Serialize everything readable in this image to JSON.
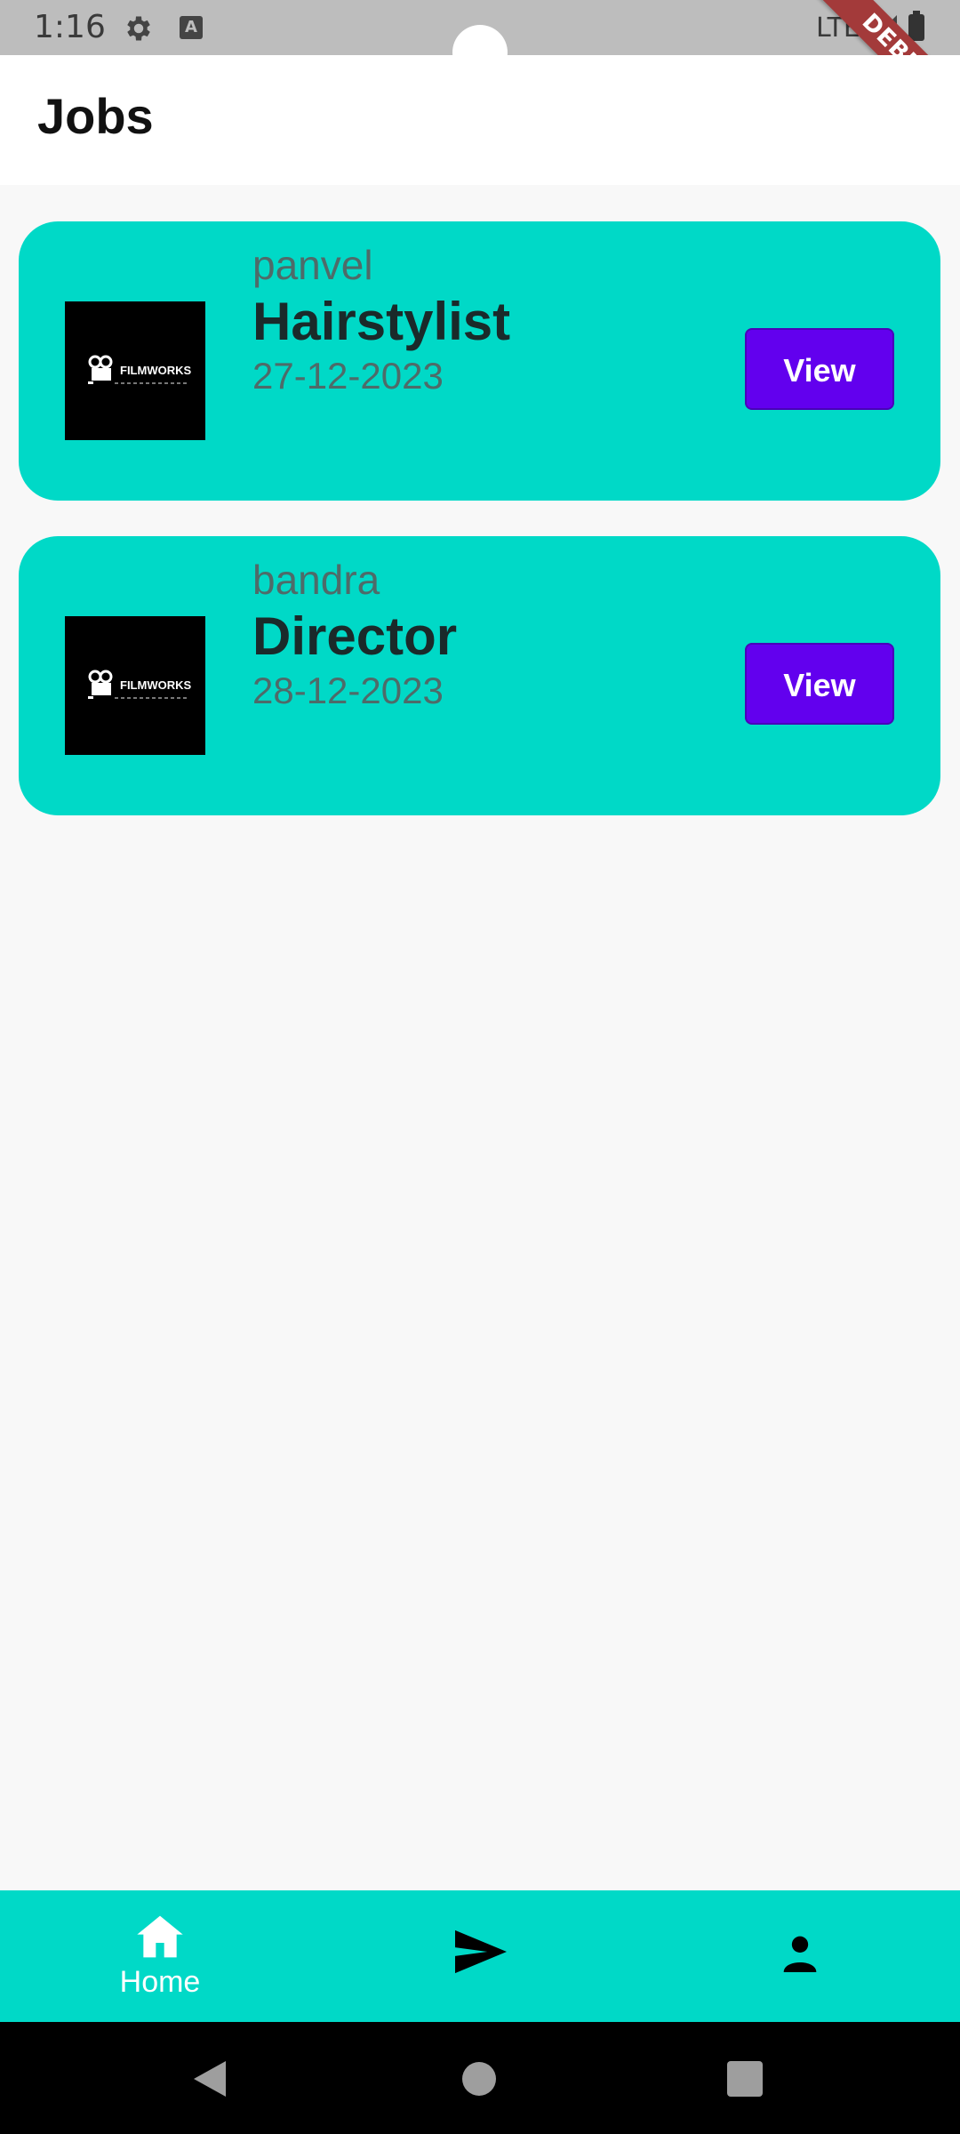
{
  "status_bar": {
    "time": "1:16",
    "network": "LTE",
    "debug_banner": "DEBUG",
    "icons": [
      "gear-icon",
      "keyboard-a-icon",
      "signal-icon",
      "battery-icon"
    ]
  },
  "app_bar": {
    "title": "Jobs"
  },
  "jobs": [
    {
      "location": "panvel",
      "title": "Hairstylist",
      "date": "27-12-2023",
      "button_label": "View",
      "logo_text": "FILMWORKS"
    },
    {
      "location": "bandra",
      "title": "Director",
      "date": "28-12-2023",
      "button_label": "View",
      "logo_text": "FILMWORKS"
    }
  ],
  "bottom_nav": {
    "items": [
      {
        "label": "Home",
        "icon": "home-icon",
        "active": true
      },
      {
        "label": "",
        "icon": "send-icon",
        "active": false
      },
      {
        "label": "",
        "icon": "person-icon",
        "active": false
      }
    ]
  },
  "colors": {
    "card": "#00d9c7",
    "button": "#6200ee",
    "nav": "#00d9c7",
    "debug": "#a33a3a"
  }
}
